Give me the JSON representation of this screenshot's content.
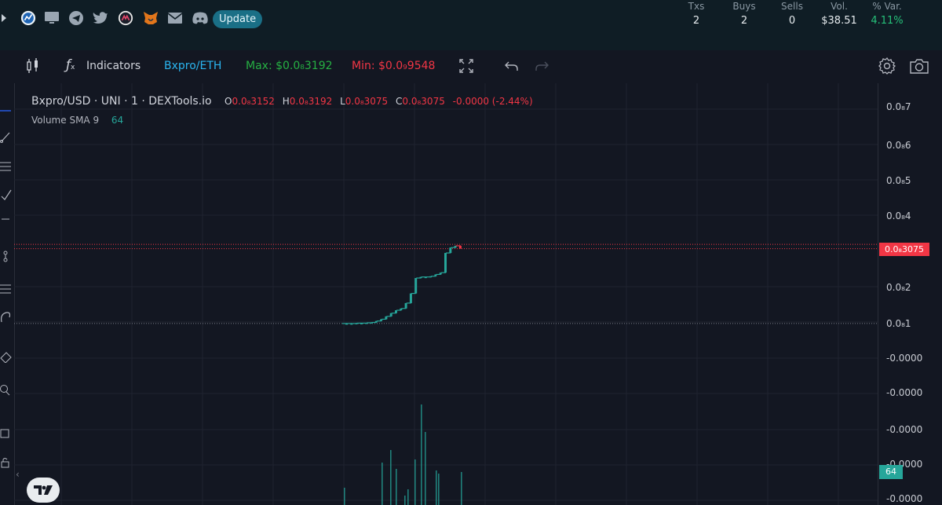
{
  "topbar": {
    "update_label": "Update",
    "stats": [
      {
        "header": "Txs",
        "value": "2"
      },
      {
        "header": "Buys",
        "value": "2"
      },
      {
        "header": "Sells",
        "value": "0"
      },
      {
        "header": "Vol.",
        "value": "$38.51"
      },
      {
        "header": "% Var.",
        "value": "4.11%"
      }
    ],
    "icons": [
      "chevron-right-icon",
      "dextools-icon",
      "monitor-icon",
      "telegram-icon",
      "twitter-icon",
      "coin-icon",
      "metamask-icon",
      "mail-icon",
      "discord-icon"
    ]
  },
  "toolbar": {
    "indicators_label": "Indicators",
    "pair_label": "Bxpro/ETH",
    "max_label": "Max: $0.0₈3192",
    "min_label": "Min: $0.0₉9548"
  },
  "legend": {
    "symbol": "Bxpro/USD · UNI · 1 · DEXTools.io",
    "o_label": "O",
    "o_value": "0.0₈3152",
    "h_label": "H",
    "h_value": "0.0₈3192",
    "l_label": "L",
    "l_value": "0.0₈3075",
    "c_label": "C",
    "c_value": "0.0₈3075",
    "change": "-0.0000 (-2.44%)",
    "volume_label": "Volume SMA 9",
    "volume_value": "64"
  },
  "yaxis": {
    "ticks": [
      "0.0₈7",
      "0.0₈6",
      "0.0₈5",
      "0.0₈4",
      "0.0₈3075",
      "0.0₈2",
      "0.0₈1",
      "-0.0000",
      "-0.0000",
      "-0.0000",
      "-0.0000",
      "-0.0000"
    ],
    "current_price_tag": "0.0₈3075",
    "volume_tag": "64"
  },
  "colors": {
    "up": "#26a69a",
    "down": "#f23645",
    "background": "#131722",
    "topbar": "#0f1d25"
  },
  "chart_data": {
    "type": "candlestick",
    "y_unit": "×1e-9 USD",
    "price_range": [
      0.98,
      3.19
    ],
    "closes": [
      0.98,
      0.98,
      0.99,
      0.99,
      1.0,
      1.01,
      1.05,
      1.1,
      1.18,
      1.27,
      1.35,
      1.4,
      1.55,
      1.82,
      2.25,
      2.28,
      2.28,
      2.3,
      2.35,
      2.4,
      2.95,
      3.1,
      3.15,
      3.07
    ],
    "volumes": [
      0,
      0,
      0,
      0,
      0,
      0,
      0,
      0,
      0,
      0,
      0,
      0,
      0,
      0,
      0,
      0,
      0,
      0,
      0,
      0,
      0,
      0,
      0,
      64
    ]
  }
}
